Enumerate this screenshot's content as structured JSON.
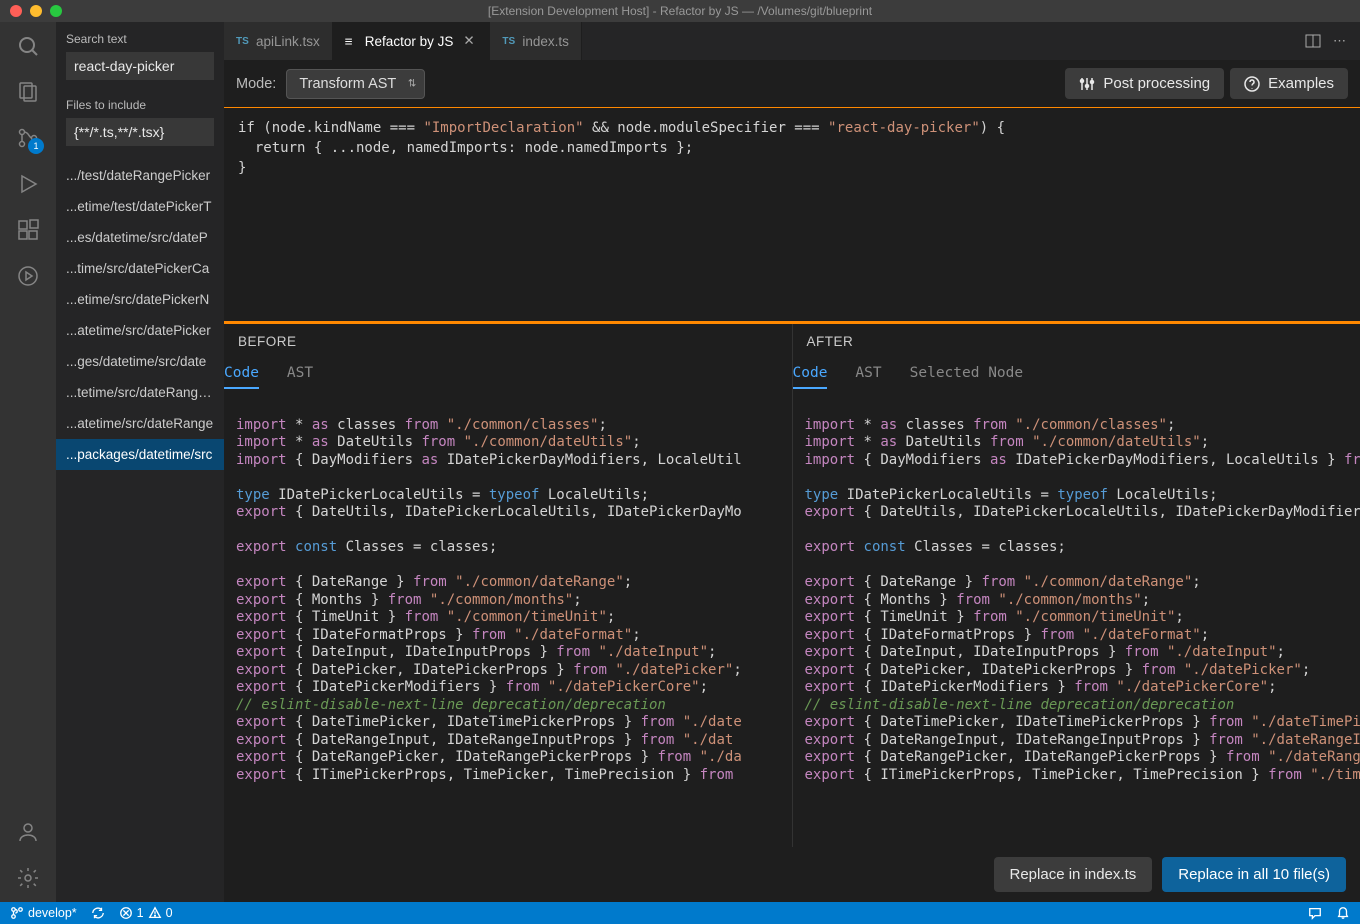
{
  "titlebar": {
    "title": "[Extension Development Host] - Refactor by JS — /Volumes/git/blueprint"
  },
  "activity": {
    "scm_badge": "1"
  },
  "tabs": {
    "tab1": "apiLink.tsx",
    "tab2": "Refactor by JS",
    "tab3": "index.ts"
  },
  "sidebar": {
    "search_label": "Search text",
    "search_value": "react-day-picker",
    "files_label": "Files to include",
    "files_value": "{**/*.ts,**/*.tsx}",
    "items": [
      ".../test/dateRangePicker",
      "...etime/test/datePickerT",
      "...es/datetime/src/dateP",
      "...time/src/datePickerCa",
      "...etime/src/datePickerN",
      "...atetime/src/datePicker",
      "...ges/datetime/src/date",
      "...tetime/src/dateRangeP",
      "...atetime/src/dateRange",
      "...packages/datetime/src"
    ]
  },
  "toolbar": {
    "mode_label": "Mode:",
    "mode_value": "Transform AST",
    "post_processing": "Post processing",
    "examples": "Examples"
  },
  "code": {
    "line1_a": "if (node.kindName === ",
    "line1_s1": "\"ImportDeclaration\"",
    "line1_b": " && node.moduleSpecifier === ",
    "line1_s2": "\"react-day-picker\"",
    "line1_c": ") {",
    "line2": "  return { ...node, namedImports: node.namedImports };",
    "line3": "}"
  },
  "diff": {
    "before_label": "BEFORE",
    "after_label": "AFTER",
    "tab_code": "Code",
    "tab_ast": "AST",
    "tab_selected": "Selected Node"
  },
  "before_code": {
    "l1a": "import",
    "l1b": " * ",
    "l1c": "as",
    "l1d": " classes ",
    "l1e": "from",
    "l1f": " ",
    "l1g": "\"./common/classes\"",
    "l1h": ";",
    "l2a": "import",
    "l2b": " * ",
    "l2c": "as",
    "l2d": " DateUtils ",
    "l2e": "from",
    "l2f": " ",
    "l2g": "\"./common/dateUtils\"",
    "l2h": ";",
    "l3a": "import",
    "l3b": " { DayModifiers ",
    "l3c": "as",
    "l3d": " IDatePickerDayModifiers, LocaleUtil",
    "l4": "",
    "l5a": "type",
    "l5b": " IDatePickerLocaleUtils = ",
    "l5c": "typeof",
    "l5d": " LocaleUtils;",
    "l6a": "export",
    "l6b": " { DateUtils, IDatePickerLocaleUtils, IDatePickerDayMo",
    "l7": "",
    "l8a": "export",
    "l8b": " ",
    "l8c": "const",
    "l8d": " Classes = classes;",
    "l9": "",
    "l10a": "export",
    "l10b": " { DateRange } ",
    "l10c": "from",
    "l10d": " ",
    "l10e": "\"./common/dateRange\"",
    "l10f": ";",
    "l11a": "export",
    "l11b": " { Months } ",
    "l11c": "from",
    "l11d": " ",
    "l11e": "\"./common/months\"",
    "l11f": ";",
    "l12a": "export",
    "l12b": " { TimeUnit } ",
    "l12c": "from",
    "l12d": " ",
    "l12e": "\"./common/timeUnit\"",
    "l12f": ";",
    "l13a": "export",
    "l13b": " { IDateFormatProps } ",
    "l13c": "from",
    "l13d": " ",
    "l13e": "\"./dateFormat\"",
    "l13f": ";",
    "l14a": "export",
    "l14b": " { DateInput, IDateInputProps } ",
    "l14c": "from",
    "l14d": " ",
    "l14e": "\"./dateInput\"",
    "l14f": ";",
    "l15a": "export",
    "l15b": " { DatePicker, IDatePickerProps } ",
    "l15c": "from",
    "l15d": " ",
    "l15e": "\"./datePicker\"",
    "l15f": ";",
    "l16a": "export",
    "l16b": " { IDatePickerModifiers } ",
    "l16c": "from",
    "l16d": " ",
    "l16e": "\"./datePickerCore\"",
    "l16f": ";",
    "l17": "// eslint-disable-next-line deprecation/deprecation",
    "l18a": "export",
    "l18b": " { DateTimePicker, IDateTimePickerProps } ",
    "l18c": "from",
    "l18d": " ",
    "l18e": "\"./date",
    "l19a": "export",
    "l19b": " { DateRangeInput, IDateRangeInputProps } ",
    "l19c": "from",
    "l19d": " ",
    "l19e": "\"./dat",
    "l20a": "export",
    "l20b": " { DateRangePicker, IDateRangePickerProps } ",
    "l20c": "from",
    "l20d": " ",
    "l20e": "\"./da",
    "l21a": "export",
    "l21b": " { ITimePickerProps, TimePicker, TimePrecision } ",
    "l21c": "from"
  },
  "after_code": {
    "l1a": "import",
    "l1b": " * ",
    "l1c": "as",
    "l1d": " classes ",
    "l1e": "from",
    "l1f": " ",
    "l1g": "\"./common/classes\"",
    "l1h": ";",
    "l2a": "import",
    "l2b": " * ",
    "l2c": "as",
    "l2d": " DateUtils ",
    "l2e": "from",
    "l2f": " ",
    "l2g": "\"./common/dateUtils\"",
    "l2h": ";",
    "l3a": "import",
    "l3b": " { DayModifiers ",
    "l3c": "as",
    "l3d": " IDatePickerDayModifiers, LocaleUtils } ",
    "l3e": "fr",
    "l4": "",
    "l5a": "type",
    "l5b": " IDatePickerLocaleUtils = ",
    "l5c": "typeof",
    "l5d": " LocaleUtils;",
    "l6a": "export",
    "l6b": " { DateUtils, IDatePickerLocaleUtils, IDatePickerDayModifier",
    "l7": "",
    "l8a": "export",
    "l8b": " ",
    "l8c": "const",
    "l8d": " Classes = classes;",
    "l9": "",
    "l10a": "export",
    "l10b": " { DateRange } ",
    "l10c": "from",
    "l10d": " ",
    "l10e": "\"./common/dateRange\"",
    "l10f": ";",
    "l11a": "export",
    "l11b": " { Months } ",
    "l11c": "from",
    "l11d": " ",
    "l11e": "\"./common/months\"",
    "l11f": ";",
    "l12a": "export",
    "l12b": " { TimeUnit } ",
    "l12c": "from",
    "l12d": " ",
    "l12e": "\"./common/timeUnit\"",
    "l12f": ";",
    "l13a": "export",
    "l13b": " { IDateFormatProps } ",
    "l13c": "from",
    "l13d": " ",
    "l13e": "\"./dateFormat\"",
    "l13f": ";",
    "l14a": "export",
    "l14b": " { DateInput, IDateInputProps } ",
    "l14c": "from",
    "l14d": " ",
    "l14e": "\"./dateInput\"",
    "l14f": ";",
    "l15a": "export",
    "l15b": " { DatePicker, IDatePickerProps } ",
    "l15c": "from",
    "l15d": " ",
    "l15e": "\"./datePicker\"",
    "l15f": ";",
    "l16a": "export",
    "l16b": " { IDatePickerModifiers } ",
    "l16c": "from",
    "l16d": " ",
    "l16e": "\"./datePickerCore\"",
    "l16f": ";",
    "l17": "// eslint-disable-next-line deprecation/deprecation",
    "l18a": "export",
    "l18b": " { DateTimePicker, IDateTimePickerProps } ",
    "l18c": "from",
    "l18d": " ",
    "l18e": "\"./dateTimePi",
    "l19a": "export",
    "l19b": " { DateRangeInput, IDateRangeInputProps } ",
    "l19c": "from",
    "l19d": " ",
    "l19e": "\"./dateRangeI",
    "l20a": "export",
    "l20b": " { DateRangePicker, IDateRangePickerProps } ",
    "l20c": "from",
    "l20d": " ",
    "l20e": "\"./dateRang",
    "l21a": "export",
    "l21b": " { ITimePickerProps, TimePicker, TimePrecision } ",
    "l21c": "from",
    "l21d": " ",
    "l21e": "\"./tim"
  },
  "footer": {
    "replace_one": "Replace in index.ts",
    "replace_all": "Replace in all 10 file(s)"
  },
  "statusbar": {
    "branch": "develop*",
    "errors": "1",
    "warnings": "0"
  }
}
